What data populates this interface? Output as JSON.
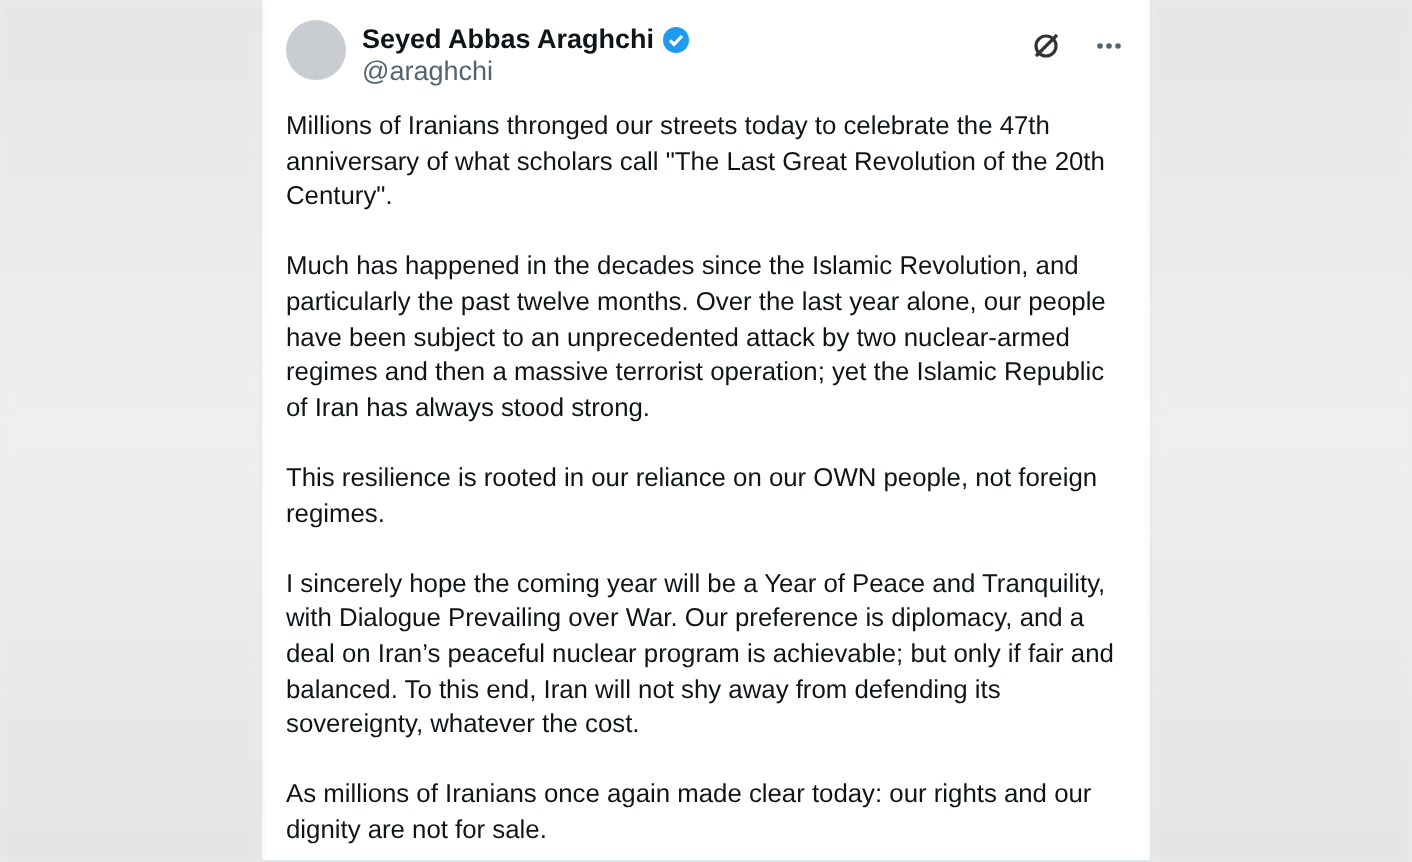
{
  "post": {
    "author": {
      "name": "Seyed Abbas Araghchi",
      "handle": "@araghchi",
      "verified": true
    },
    "paragraphs": [
      "Millions of Iranians thronged our streets today to celebrate the 47th\nanniversary of what scholars call \"The Last Great Revolution of the 20th\nCentury\".",
      "Much has happened in the decades since the Islamic Revolution, and\nparticularly the past twelve months. Over the last year alone, our people\nhave been subject to an unprecedented attack by two nuclear-armed\nregimes and then a massive terrorist operation; yet the Islamic Republic\nof Iran has always stood strong.",
      "This resilience is rooted in our reliance on our OWN people, not foreign\nregimes.",
      "I sincerely hope the coming year will be a Year of Peace and Tranquility,\nwith Dialogue Prevailing over War. Our preference is diplomacy, and a\ndeal on Iran’s peaceful nuclear program is achievable; but only if fair and\nbalanced. To this end, Iran will not shy away from defending its\nsovereignty, whatever the cost.",
      "As millions of Iranians once again made clear today: our rights and our\ndignity are not for sale."
    ]
  }
}
